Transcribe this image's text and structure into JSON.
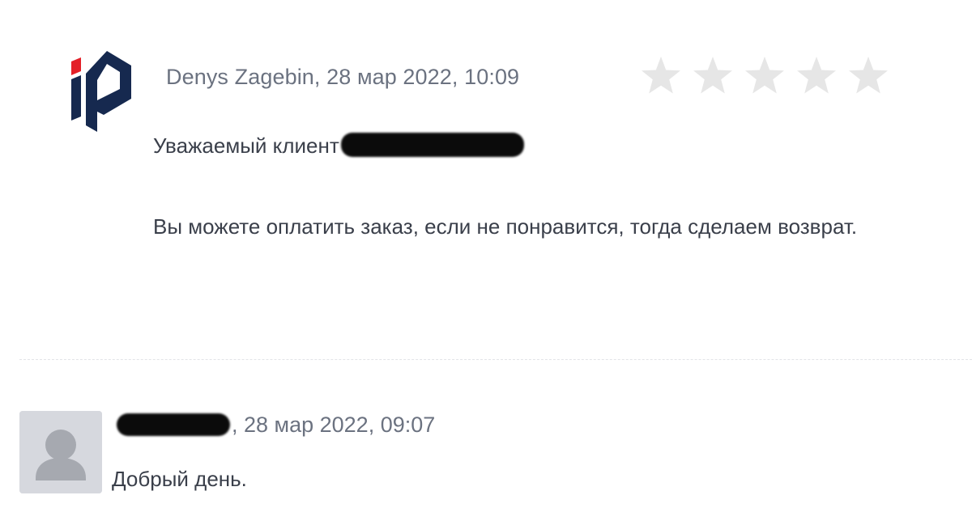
{
  "reply": {
    "author": "Denys Zagebin",
    "meta_line": "Denys Zagebin, 28 мар 2022, 10:09",
    "date": "28 мар 2022, 10:09",
    "greeting": "Уважаемый клиент",
    "text": "Вы можете оплатить заказ, если не понравится, тогда сделаем возврат.",
    "rating": {
      "value": 0,
      "max": 5,
      "star_color": "#e6e6e6"
    },
    "logo_icon": "ip-logo-icon",
    "logo_colors": {
      "primary": "#16294f",
      "accent": "#e32028"
    }
  },
  "customer_comment": {
    "meta_suffix": ", 28 мар 2022, 09:07",
    "date": "28 мар 2022, 09:07",
    "text": "Добрый день.",
    "avatar_icon": "user-avatar-icon",
    "avatar_colors": {
      "background": "#d6d8de",
      "figure": "#a6a9b0"
    }
  },
  "colors": {
    "meta_text": "#6b7280",
    "body_text": "#3a3f4a",
    "divider": "#e2e4e8"
  }
}
